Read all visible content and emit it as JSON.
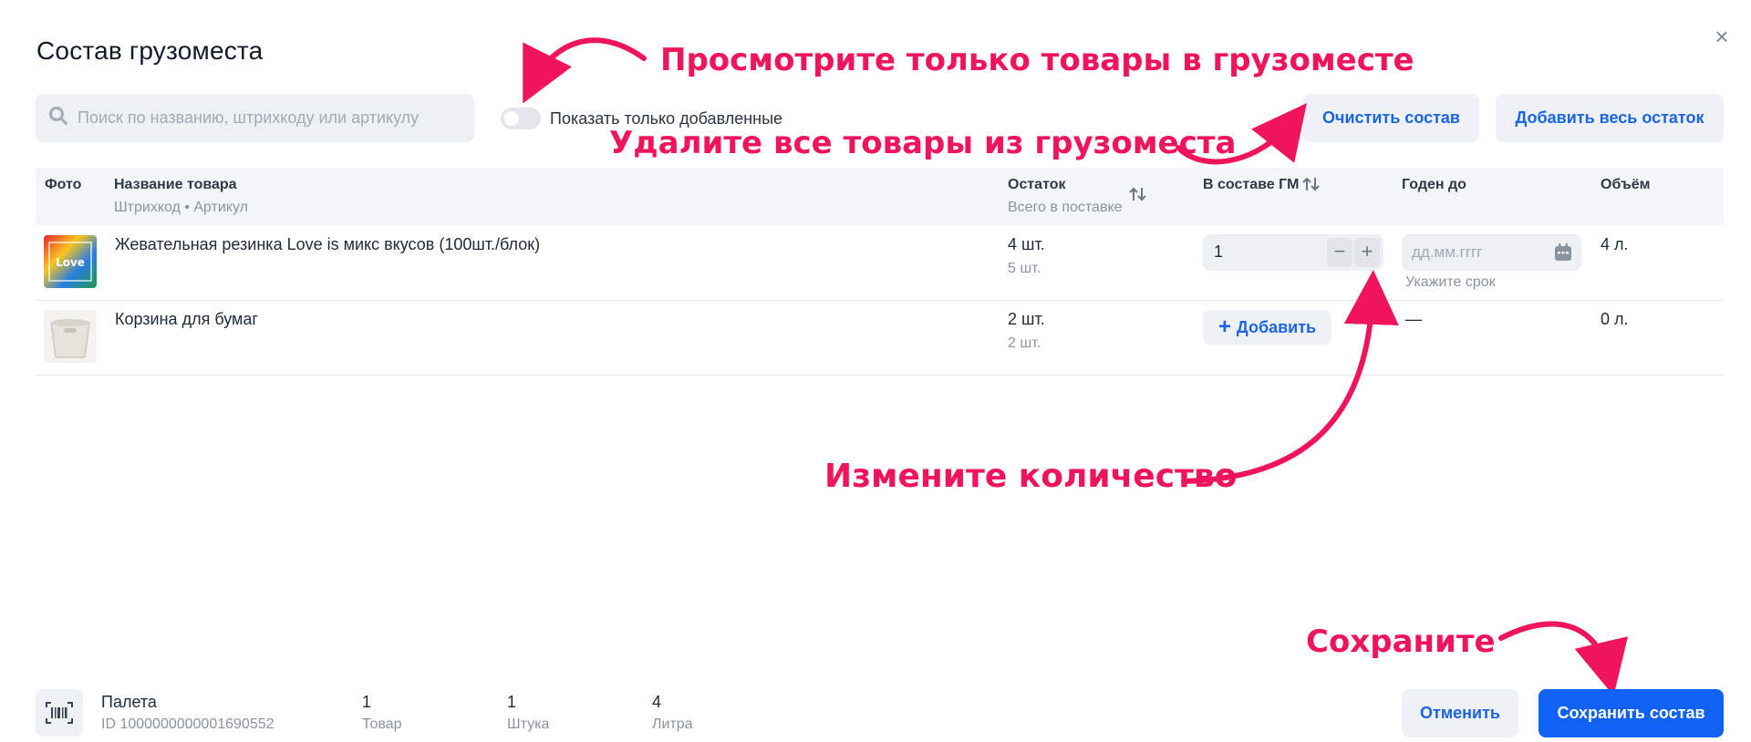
{
  "modal": {
    "title": "Состав грузоместа",
    "close_icon": "×"
  },
  "toolbar": {
    "search_placeholder": "Поиск по названию, штрихкоду или артикулу",
    "toggle_label": "Показать только добавленные",
    "toggle_on": false,
    "clear_label": "Очистить состав",
    "add_all_label": "Добавить весь остаток"
  },
  "table": {
    "headers": {
      "photo": "Фото",
      "name": "Название товара",
      "name_sub": "Штрихкод • Артикул",
      "stock": "Остаток",
      "stock_sub": "Всего в поставке",
      "in_gm": "В составе ГМ",
      "expiry": "Годен до",
      "volume": "Объём"
    },
    "rows": [
      {
        "name": "Жевательная резинка Love is микс вкусов (100шт./блок)",
        "stock": "4 шт.",
        "stock_total": "5 шт.",
        "qty": "1",
        "date_placeholder": "дд.мм.гггг",
        "date_hint": "Укажите срок",
        "volume": "4 л."
      },
      {
        "name": "Корзина для бумаг",
        "stock": "2 шт.",
        "stock_total": "2 шт.",
        "add_label": "Добавить",
        "expiry": "—",
        "volume": "0 л."
      }
    ]
  },
  "annotations": {
    "view_only": "Просмотрите только товары в грузоместе",
    "clear_all": "Удалите все товары из грузоместа",
    "change_qty": "Измените количество",
    "save": "Сохраните"
  },
  "footer": {
    "type": "Палета",
    "id": "ID 1000000000001690552",
    "stats": [
      {
        "value": "1",
        "label": "Товар"
      },
      {
        "value": "1",
        "label": "Штука"
      },
      {
        "value": "4",
        "label": "Литра"
      }
    ],
    "cancel_label": "Отменить",
    "save_label": "Сохранить состав"
  },
  "colors": {
    "accent": "#0f62f4",
    "annotation": "#f0155a"
  }
}
